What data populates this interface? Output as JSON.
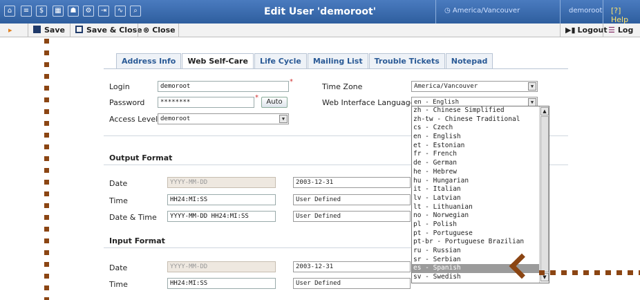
{
  "header": {
    "title": "Edit User 'demoroot'",
    "timezone": "America/Vancouver",
    "user": "demoroot",
    "help": "Help"
  },
  "toolbar": {
    "save": "Save",
    "save_close": "Save & Close",
    "close": "Close",
    "logout": "Logout",
    "log": "Log"
  },
  "tabs": [
    "Address Info",
    "Web Self-Care",
    "Life Cycle",
    "Mailing List",
    "Trouble Tickets",
    "Notepad"
  ],
  "form": {
    "login_label": "Login",
    "login_value": "demoroot",
    "password_label": "Password",
    "password_value": "********",
    "auto_button": "Auto",
    "access_level_label": "Access Level",
    "access_level_value": "demoroot",
    "timezone_label": "Time Zone",
    "timezone_value": "America/Vancouver",
    "language_label": "Web Interface Language",
    "language_value": "en - English"
  },
  "output_format": {
    "title": "Output Format",
    "date_label": "Date",
    "date_value": "YYYY-MM-DD",
    "date_select": "2003-12-31",
    "time_label": "Time",
    "time_value": "HH24:MI:SS",
    "time_select": "User Defined",
    "datetime_label": "Date & Time",
    "datetime_value": "YYYY-MM-DD HH24:MI:SS",
    "datetime_select": "User Defined"
  },
  "input_format": {
    "title": "Input Format",
    "date_label": "Date",
    "date_value": "YYYY-MM-DD",
    "date_select": "2003-12-31",
    "time_label": "Time",
    "time_value": "HH24:MI:SS",
    "time_select": "User Defined"
  },
  "language_options": [
    "zh - Chinese Simplified",
    "zh-tw - Chinese Traditional",
    "cs - Czech",
    "en - English",
    "et - Estonian",
    "fr - French",
    "de - German",
    "he - Hebrew",
    "hu - Hungarian",
    "it - Italian",
    "lv - Latvian",
    "lt - Lithuanian",
    "no - Norwegian",
    "pl - Polish",
    "pt - Portuguese",
    "pt-br - Portuguese Brazilian",
    "ru - Russian",
    "sr - Serbian",
    "es - Spanish",
    "sv - Swedish"
  ],
  "highlighted_option": "es - Spanish",
  "colors": {
    "header_bg": "#2e5e9e",
    "tab_text": "#2a5a96",
    "pointer": "#8b4513",
    "highlight": "#9b9b9b",
    "required": "#d03030"
  }
}
